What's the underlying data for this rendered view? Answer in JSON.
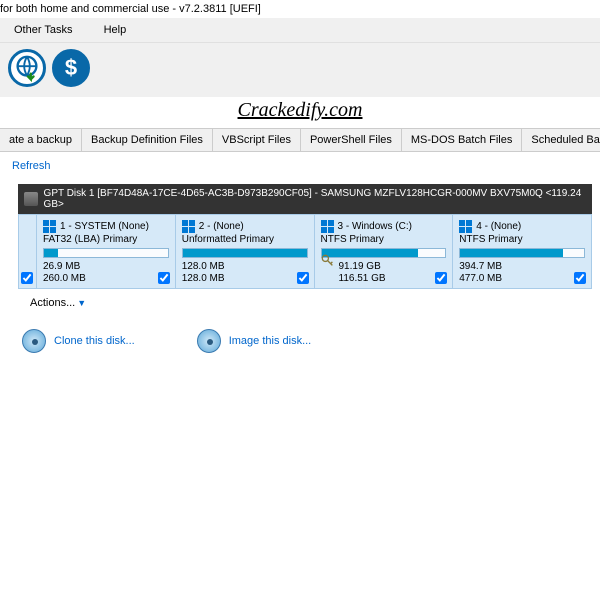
{
  "title": "for both home and commercial use - v7.2.3811  [UEFI]",
  "menu": {
    "other": "Other Tasks",
    "help": "Help"
  },
  "watermark": "Crackedify.com",
  "tabs": {
    "t0": "ate a backup",
    "t1": "Backup Definition Files",
    "t2": "VBScript Files",
    "t3": "PowerShell Files",
    "t4": "MS-DOS Batch Files",
    "t5": "Scheduled Backups"
  },
  "refresh": "Refresh",
  "disk": {
    "header": "GPT Disk 1 [BF74D48A-17CE-4D65-AC3B-D973B290CF05] - SAMSUNG MZFLV128HCGR-000MV BXV75M0Q  <119.24 GB>"
  },
  "partitions": [
    {
      "title": "1 - SYSTEM (None)",
      "type": "FAT32 (LBA) Primary",
      "used": "26.9 MB",
      "total": "260.0 MB",
      "fill": 11,
      "key": false
    },
    {
      "title": "2 -  (None)",
      "type": "Unformatted Primary",
      "used": "128.0 MB",
      "total": "128.0 MB",
      "fill": 100,
      "key": false
    },
    {
      "title": "3 - Windows (C:)",
      "type": "NTFS Primary",
      "used": "91.19 GB",
      "total": "116.51 GB",
      "fill": 78,
      "key": true
    },
    {
      "title": "4 -  (None)",
      "type": "NTFS Primary",
      "used": "394.7 MB",
      "total": "477.0 MB",
      "fill": 83,
      "key": false
    }
  ],
  "actions": "Actions...",
  "ops": {
    "clone": "Clone this disk...",
    "image": "Image this disk..."
  }
}
